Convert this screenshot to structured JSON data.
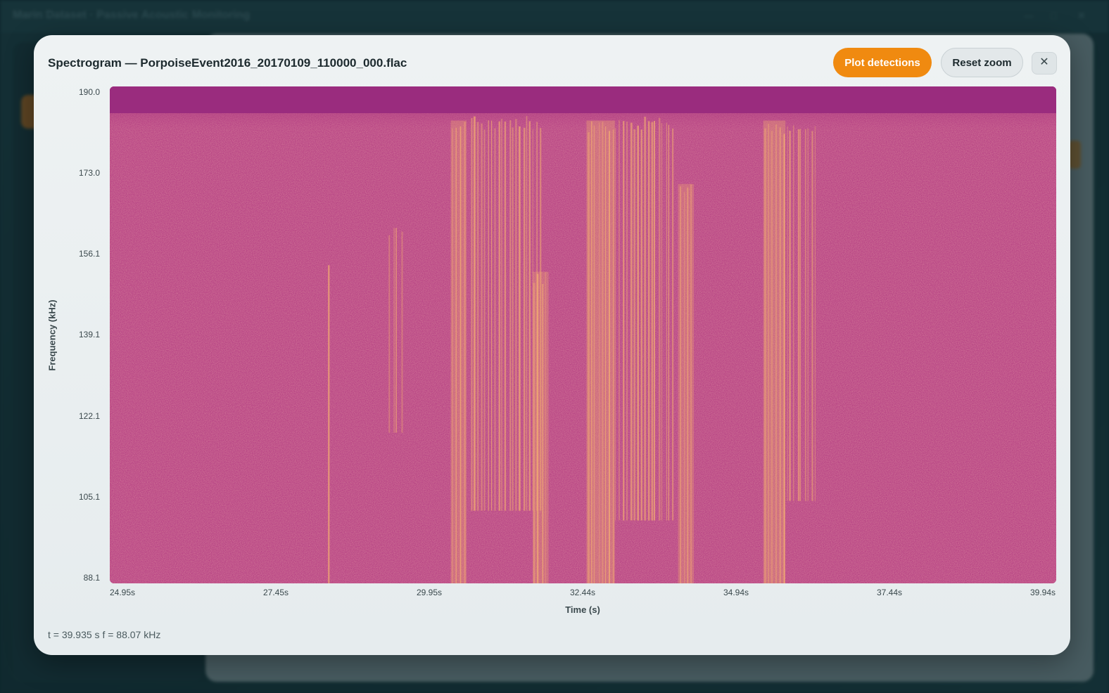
{
  "background": {
    "window_title": "Marin Dataset · Passive Acoustic Monitoring"
  },
  "modal": {
    "title": "Spectrogram — PorpoiseEvent2016_20170109_110000_000.flac",
    "plot_detections_label": "Plot detections",
    "reset_zoom_label": "Reset zoom",
    "close_icon": "close-icon",
    "readout": "t = 39.935 s f = 88.07 kHz"
  },
  "colors": {
    "accent": "#f08a10",
    "spectrogram_low": "#b53f83",
    "spectrogram_high": "#f4b070",
    "spectrogram_top_band": "#9a2c7e"
  },
  "chart_data": {
    "type": "heatmap",
    "title": "",
    "xlabel": "Time (s)",
    "ylabel": "Frequency (kHz)",
    "x_ticks": [
      "24.95s",
      "27.45s",
      "29.95s",
      "32.44s",
      "34.94s",
      "37.44s",
      "39.94s"
    ],
    "y_ticks": [
      "190.0",
      "173.0",
      "156.1",
      "139.1",
      "122.1",
      "105.1",
      "88.1"
    ],
    "xlim": [
      24.95,
      39.94
    ],
    "ylim": [
      88.1,
      190.0
    ],
    "events": [
      {
        "t_start": 30.35,
        "t_end": 30.6,
        "f_low": 88.1,
        "f_high": 183.0,
        "intensity": 0.9
      },
      {
        "t_start": 30.65,
        "t_end": 31.8,
        "f_low": 103.0,
        "f_high": 184.0,
        "intensity": 0.7
      },
      {
        "t_start": 31.65,
        "t_end": 31.9,
        "f_low": 88.1,
        "f_high": 152.0,
        "intensity": 0.85
      },
      {
        "t_start": 32.5,
        "t_end": 32.95,
        "f_low": 88.1,
        "f_high": 183.0,
        "intensity": 1.0
      },
      {
        "t_start": 32.95,
        "t_end": 33.9,
        "f_low": 101.0,
        "f_high": 184.0,
        "intensity": 0.7
      },
      {
        "t_start": 33.95,
        "t_end": 34.2,
        "f_low": 88.1,
        "f_high": 170.0,
        "intensity": 0.85
      },
      {
        "t_start": 35.3,
        "t_end": 35.65,
        "f_low": 88.1,
        "f_high": 183.0,
        "intensity": 0.95
      },
      {
        "t_start": 35.65,
        "t_end": 36.15,
        "f_low": 105.0,
        "f_high": 183.0,
        "intensity": 0.6
      },
      {
        "t_start": 28.4,
        "t_end": 28.42,
        "f_low": 88.1,
        "f_high": 156.0,
        "intensity": 0.6
      },
      {
        "t_start": 29.35,
        "t_end": 29.6,
        "f_low": 119.0,
        "f_high": 162.0,
        "intensity": 0.45
      }
    ]
  }
}
